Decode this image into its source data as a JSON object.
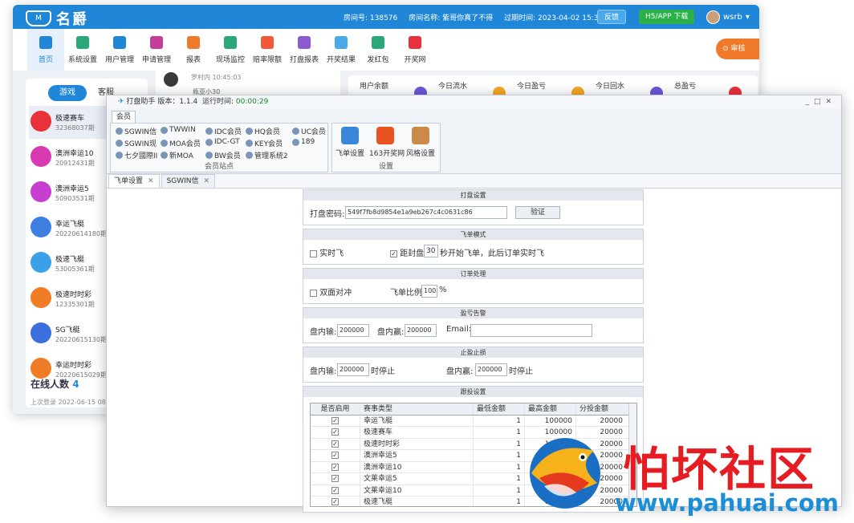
{
  "back": {
    "logo": "名爵",
    "logo_mark": "M",
    "info": {
      "room_no": "房间号: 138576",
      "room_name": "房间名称: 紫哥你真了不得",
      "expire": "过期时间: 2023-04-02 15:39:32"
    },
    "feedback": "反馈",
    "app": "H5/APP 下载",
    "username": "wsrb",
    "toggle": "审核",
    "nav": [
      "首页",
      "系统设置",
      "用户管理",
      "申请管理",
      "报表",
      "现场监控",
      "赔率限额",
      "打盘报表",
      "开奖结果",
      "发红包",
      "开奖网"
    ],
    "tabs": [
      "游戏",
      "客服"
    ],
    "games": [
      {
        "name": "极速赛车",
        "num": "32368037期",
        "color": "#e8313a"
      },
      {
        "name": "澳洲幸运10",
        "num": "20912431期",
        "color": "#d93ab3"
      },
      {
        "name": "澳洲幸运5",
        "num": "50903531期",
        "color": "#c63fd0"
      },
      {
        "name": "幸运飞艇",
        "num": "20220614180期",
        "color": "#3d7fe0"
      },
      {
        "name": "极速飞艇",
        "num": "53005361期",
        "color": "#3aa0e8"
      },
      {
        "name": "极速时时彩",
        "num": "12335301期",
        "color": "#f07d25"
      },
      {
        "name": "SG飞艇",
        "num": "20220615130期",
        "color": "#3b6fde"
      },
      {
        "name": "幸运时时彩",
        "num": "20220615029期",
        "color": "#f07d25"
      }
    ],
    "online_label": "在线人数",
    "online_count": "4",
    "last_login": "上次登录 2022-06-15 08:4",
    "msg": {
      "author": "罗村内 10:45:03",
      "text": "瓶亚小30"
    },
    "stats": [
      "用户余额",
      "今日流水",
      "今日盈亏",
      "今日回水",
      "总盈亏"
    ]
  },
  "front": {
    "title_app": "打盘助手",
    "version_label": "版本：",
    "version": "1.1.4",
    "runtime_label": "运行时间:",
    "runtime": "00:00:29",
    "ribbon_tab": "会员",
    "members": [
      "SGWIN信",
      "TWWIN",
      "IDC会员",
      "HQ会员",
      "UC会员",
      "SGWIN现",
      "MOA会员",
      "IDC-GT",
      "KEY会员",
      "189",
      "七夕國際II",
      "新MOA",
      "BW会员",
      "管理系统2"
    ],
    "group_members_caption": "会员站点",
    "settings": [
      "飞单设置",
      "163开奖网",
      "风格设置"
    ],
    "group_settings_caption": "设置",
    "doctabs": [
      "飞单设置",
      "SGWIN信"
    ],
    "sections": {
      "s1": {
        "head": "打盘设置",
        "label": "打盘密码:",
        "value": "549f7fb8d9854e1a9eb267c4c0631c86",
        "btn": "验证"
      },
      "s2": {
        "head": "飞单模式",
        "realtime": "实时飞",
        "pre": "距封盘",
        "seconds": "30",
        "post": "秒开始飞单，此后订单实时飞"
      },
      "s3": {
        "head": "订单处理",
        "hedge": "双面对冲",
        "ratio_label": "飞单比例",
        "ratio": "100",
        "pct": "%"
      },
      "s4": {
        "head": "盈亏告警",
        "lose_label": "盘内输:",
        "lose": "200000",
        "win_label": "盘内赢:",
        "win": "200000",
        "email_label": "Email:"
      },
      "s5": {
        "head": "止盈止损",
        "lose_label": "盘内输:",
        "lose": "200000",
        "lose_suffix": "时停止",
        "win_label": "盘内赢:",
        "win": "200000",
        "win_suffix": "时停止"
      },
      "s6": {
        "head": "跟投设置"
      }
    },
    "table": {
      "headers": [
        "是否启用",
        "赛事类型",
        "最低金额",
        "最高金额",
        "分投金额"
      ],
      "rows": [
        [
          "幸运飞艇",
          "1",
          "100000",
          "20000"
        ],
        [
          "极速赛车",
          "1",
          "100000",
          "20000"
        ],
        [
          "极速时时彩",
          "1",
          "100000",
          "20000"
        ],
        [
          "澳洲幸运5",
          "1",
          "100000",
          "20000"
        ],
        [
          "澳洲幸运10",
          "1",
          "100000",
          "20000"
        ],
        [
          "文莱幸运5",
          "1",
          "100000",
          "20000"
        ],
        [
          "文莱幸运10",
          "1",
          "100000",
          "20000"
        ],
        [
          "极速飞艇",
          "1",
          "100000",
          "20000"
        ]
      ],
      "check": "✓"
    }
  },
  "watermark": {
    "text": "怕坏社区",
    "url": "www.pahuai.com"
  }
}
